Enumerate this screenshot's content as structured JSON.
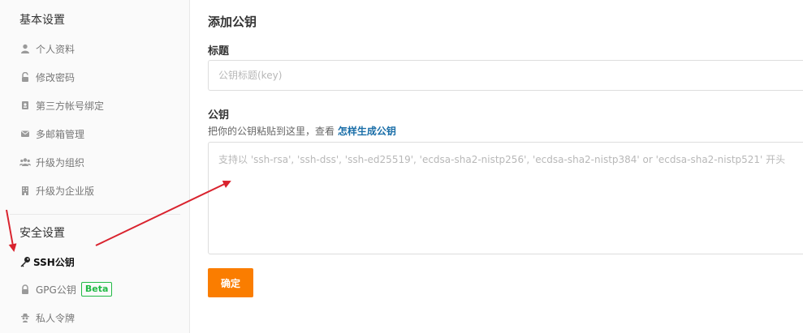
{
  "sidebar": {
    "basic_title": "基本设置",
    "basic_items": [
      {
        "label": "个人资料",
        "icon": "user-icon"
      },
      {
        "label": "修改密码",
        "icon": "unlock-icon"
      },
      {
        "label": "第三方帐号绑定",
        "icon": "id-card-icon"
      },
      {
        "label": "多邮箱管理",
        "icon": "envelope-icon"
      },
      {
        "label": "升级为组织",
        "icon": "group-icon"
      },
      {
        "label": "升级为企业版",
        "icon": "building-icon"
      }
    ],
    "security_title": "安全设置",
    "security_items": [
      {
        "label": "SSH公钥",
        "icon": "key-icon",
        "active": true
      },
      {
        "label": "GPG公钥",
        "icon": "lock-icon",
        "badge": "Beta"
      },
      {
        "label": "私人令牌",
        "icon": "spy-icon"
      }
    ]
  },
  "main": {
    "title": "添加公钥",
    "title_field": {
      "label": "标题",
      "placeholder": "公钥标题(key)"
    },
    "key_field": {
      "label": "公钥",
      "hint": "把你的公钥粘贴到这里，查看",
      "hint_link": "怎样生成公钥",
      "placeholder": "支持以 'ssh-rsa', 'ssh-dss', 'ssh-ed25519', 'ecdsa-sha2-nistp256', 'ecdsa-sha2-nistp384' or 'ecdsa-sha2-nistp521' 开头"
    },
    "confirm_label": "确定"
  },
  "colors": {
    "accent": "#fa7d00",
    "link": "#1a6ea8",
    "beta": "#21ba45",
    "annotation_arrow": "#d9232e"
  }
}
